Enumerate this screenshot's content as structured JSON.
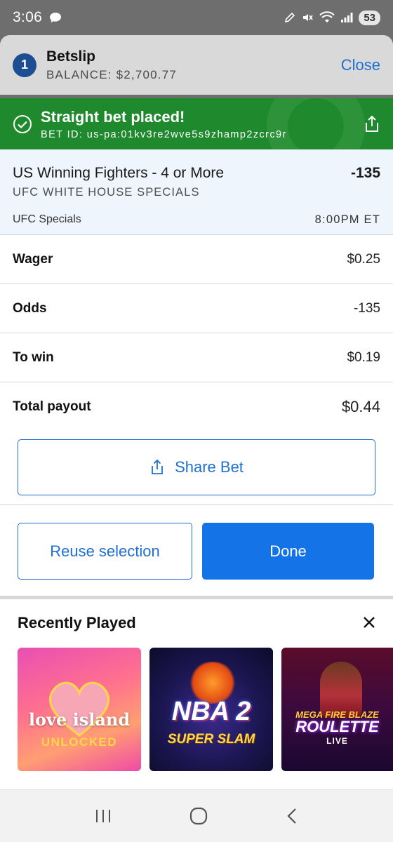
{
  "status_bar": {
    "time": "3:06",
    "battery": "53"
  },
  "header": {
    "count": "1",
    "title": "Betslip",
    "balance": "BALANCE: $2,700.77",
    "close_label": "Close"
  },
  "banner": {
    "title": "Straight bet placed!",
    "bet_id": "BET ID: us-pa:01kv3re2wve5s9zhamp2zcrc9r"
  },
  "event": {
    "title": "US Winning Fighters - 4 or More",
    "odds": "-135",
    "subtitle": "UFC WHITE HOUSE SPECIALS",
    "league": "UFC Specials",
    "time": "8:00PM ET"
  },
  "details": [
    {
      "label": "Wager",
      "value": "$0.25"
    },
    {
      "label": "Odds",
      "value": "-135"
    },
    {
      "label": "To win",
      "value": "$0.19"
    },
    {
      "label": "Total payout",
      "value": "$0.44"
    }
  ],
  "actions": {
    "share_label": "Share Bet",
    "reuse_label": "Reuse selection",
    "done_label": "Done"
  },
  "recently_played": {
    "title": "Recently Played",
    "games": [
      {
        "line1": "love island",
        "line2": "UNLOCKED"
      },
      {
        "line1": "NBA 2",
        "line2": "SUPER SLAM"
      },
      {
        "line1": "MEGA FIRE BLAZE",
        "line2": "ROULETTE",
        "line3": "LIVE"
      }
    ]
  },
  "colors": {
    "accent": "#1e6fd1",
    "success": "#1f8a2d",
    "badge": "#1d4e91",
    "done_button": "#1473e6"
  }
}
